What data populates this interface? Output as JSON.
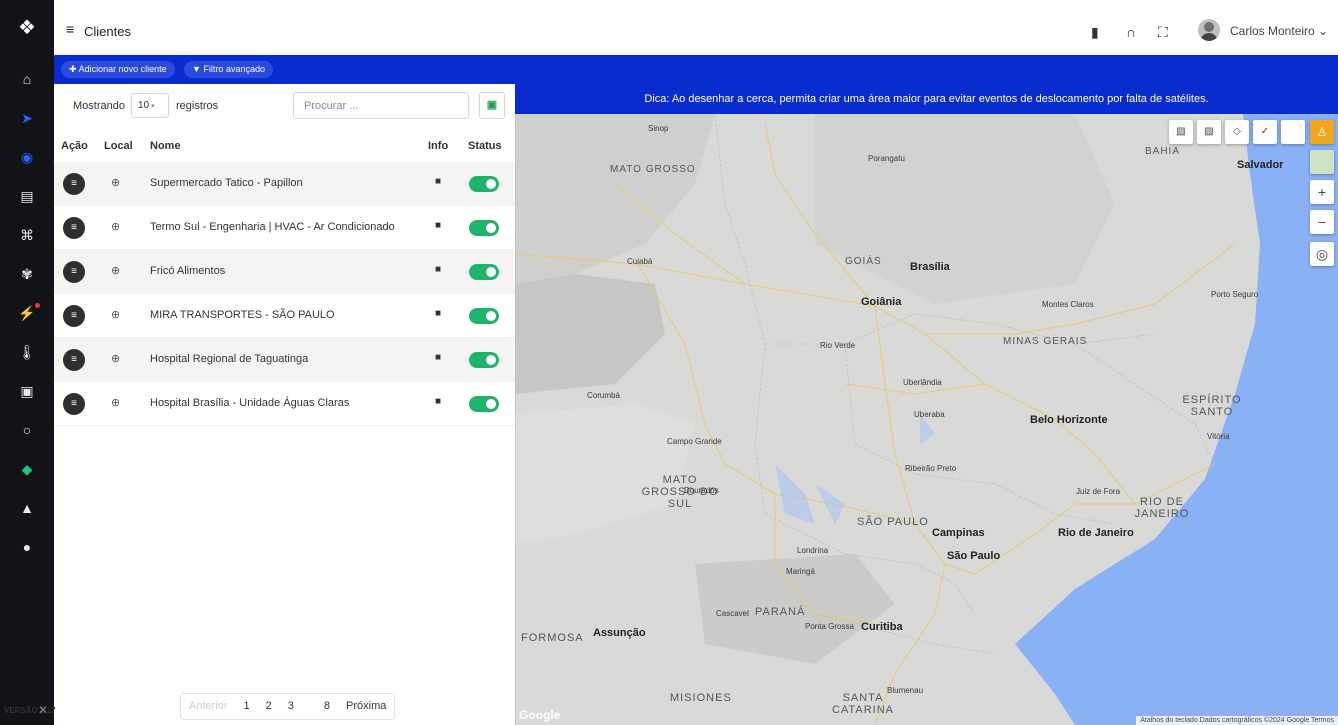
{
  "sidebar": {
    "logo": "❖",
    "items": [
      {
        "icon": "home-icon",
        "glyph": "⌂",
        "active": false
      },
      {
        "icon": "navigation-icon",
        "glyph": "➤",
        "active": true
      },
      {
        "icon": "target-icon",
        "glyph": "◉",
        "active": true
      },
      {
        "icon": "clipboard-search-icon",
        "glyph": "▤",
        "active": false
      },
      {
        "icon": "command-icon",
        "glyph": "⌘",
        "active": false
      },
      {
        "icon": "flower-icon",
        "glyph": "✾",
        "active": false
      },
      {
        "icon": "activity-icon",
        "glyph": "⚡",
        "active": false
      },
      {
        "icon": "thermometer-icon",
        "glyph": "🌡",
        "active": false
      },
      {
        "icon": "chip-icon",
        "glyph": "▣",
        "active": false
      },
      {
        "icon": "ring-icon",
        "glyph": "○",
        "active": false
      },
      {
        "icon": "diamond-icon",
        "glyph": "◆",
        "active": false
      },
      {
        "icon": "warning-icon",
        "glyph": "▲",
        "active": false
      },
      {
        "icon": "user-circle-icon",
        "glyph": "●",
        "active": false
      }
    ]
  },
  "header": {
    "menu_glyph": "≡",
    "title": "Clientes",
    "icons": {
      "book": "▮",
      "headset": "∩",
      "fullscreen": "⛶"
    },
    "user_name": "Carlos Monteiro",
    "user_caret": "⌄"
  },
  "actions": {
    "add_client": "Adicionar novo cliente",
    "advanced_filter": "Filtro avançado",
    "add_glyph": "✚",
    "filter_glyph": "▼"
  },
  "table_controls": {
    "showing_label": "Mostrando",
    "page_size": "10",
    "records_label": "registros",
    "search_placeholder": "Procurar ..."
  },
  "columns": {
    "action": "Ação",
    "local": "Local",
    "name": "Nome",
    "info": "Info",
    "status": "Status"
  },
  "clients": [
    {
      "name": "Supermercado Tatico - Papillon",
      "status": "on"
    },
    {
      "name": "Termo Sul - Engenharia | HVAC - Ar Condicionado",
      "status": "on"
    },
    {
      "name": "Fricó Alimentos",
      "status": "on"
    },
    {
      "name": "MIRA TRANSPORTES - SÃO PAULO",
      "status": "on"
    },
    {
      "name": "Hospital Regional de Taguatinga",
      "status": "on"
    },
    {
      "name": "Hospital Brasília - Unidade Águas Claras",
      "status": "on"
    }
  ],
  "pagination": {
    "prev": "Anterior",
    "pages": [
      "1",
      "2",
      "3",
      "8"
    ],
    "next": "Próxima"
  },
  "version": {
    "label": "VERSÃO 1.17"
  },
  "map": {
    "tip": "Dica: Ao desenhar a cerca, permita criar uma área maior para evitar eventos de deslocamento por falta de satélites.",
    "labels": {
      "mato_grosso": "MATO GROSSO",
      "goias": "GOIÁS",
      "bahia": "BAHIA",
      "minas_gerais": "MINAS GERAIS",
      "espirito_santo": "ESPÍRITO SANTO",
      "mato_grosso_sul": "MATO GROSSO DO SUL",
      "sao_paulo_state": "SÃO PAULO",
      "rio_de_janeiro_state": "RIO DE JANEIRO",
      "parana": "PARANÁ",
      "santa_catarina": "SANTA CATARINA",
      "missiones": "MISIONES",
      "formosa_region": "FORMOSA",
      "brasilia": "Brasília",
      "goiania": "Goiânia",
      "belo_horizonte": "Belo Horizonte",
      "campinas": "Campinas",
      "sao_paulo": "São Paulo",
      "rio_de_janeiro": "Rio de Janeiro",
      "curitiba": "Curitiba",
      "assuncao": "Assunção",
      "salvador": "Salvador",
      "cuiaba": "Cuiabá",
      "campo_grande": "Campo Grande",
      "uberlandia": "Uberlândia",
      "londrina": "Londrina",
      "sinop": "Sinop",
      "porangatu": "Porangatu",
      "montes_claros": "Montes Claros",
      "porto_seguro": "Porto Seguro",
      "vitoria": "Vitória",
      "uberaba": "Uberaba",
      "ribeirao_preto": "Ribeirão Preto",
      "juiz_de_fora": "Juiz de Fora",
      "dourados": "Dourados",
      "maringa": "Maringá",
      "cascavel": "Cascavel",
      "ponta_grossa": "Ponta Grossa",
      "blumenau": "Blumenau",
      "rio_verde": "Rio Verde",
      "corumba": "Corumbá"
    },
    "controls": {
      "zoom_in": "+",
      "zoom_out": "−",
      "locate": "◎"
    },
    "google": "Google",
    "attribution": "Atalhos do teclado   Dados cartográficos ©2024 Google   Termos"
  },
  "colors": {
    "sidebar_bg": "#111318",
    "brand_blue": "#0a2ccf",
    "status_green": "#20b36a",
    "map_water": "#8ab0f5"
  }
}
